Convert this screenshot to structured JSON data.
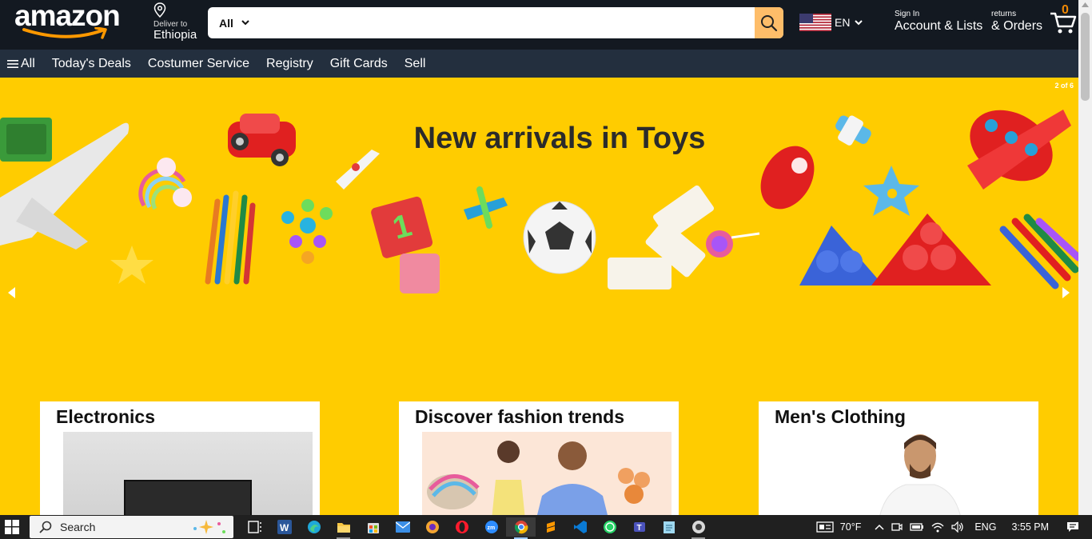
{
  "header": {
    "logo_text": "amazon",
    "deliver_label": "Deliver to",
    "deliver_location": "Ethiopia",
    "search_category": "All",
    "search_placeholder": "",
    "language": "EN",
    "account_small": "Sign In",
    "account_big": "Account & Lists",
    "orders_small": "returns",
    "orders_big": "& Orders",
    "cart_count": "0"
  },
  "nav": {
    "all": "All",
    "items": [
      "Today's Deals",
      "Costumer Service",
      "Registry",
      "Gift Cards",
      "Sell"
    ]
  },
  "hero": {
    "title": "New arrivals in Toys",
    "slide_counter": "2 of 6"
  },
  "cards": [
    {
      "title": "Electronics"
    },
    {
      "title": "Discover fashion trends"
    },
    {
      "title": "Men's Clothing"
    }
  ],
  "taskbar": {
    "search_label": "Search",
    "weather": "70°F",
    "language": "ENG",
    "time": "3:55 PM",
    "apps": [
      "task-view-icon",
      "word-icon",
      "edge-icon",
      "file-explorer-icon",
      "store-icon",
      "mail-icon",
      "brave-icon",
      "opera-icon",
      "zoom-icon",
      "chrome-icon",
      "sublime-icon",
      "vscode-icon",
      "whatsapp-icon",
      "teams-icon",
      "notepad-icon",
      "obs-icon"
    ]
  },
  "colors": {
    "header_bg": "#131921",
    "nav_bg": "#232f3e",
    "hero_bg": "#ffcc00",
    "search_button": "#febd69",
    "cart_count": "#f08804"
  }
}
